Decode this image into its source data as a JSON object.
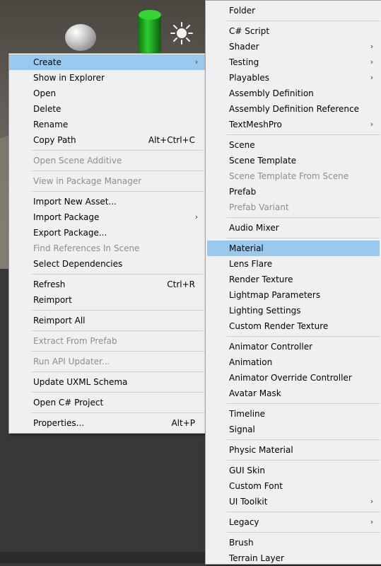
{
  "scene_icons": [
    "sphere-object",
    "cylinder-object",
    "directional-light-icon"
  ],
  "left_menu": {
    "items": [
      {
        "label": "Create",
        "submenu": true,
        "highlight": true
      },
      {
        "label": "Show in Explorer"
      },
      {
        "label": "Open"
      },
      {
        "label": "Delete"
      },
      {
        "label": "Rename"
      },
      {
        "label": "Copy Path",
        "shortcut": "Alt+Ctrl+C"
      },
      {
        "label": "Open Scene Additive",
        "disabled": true
      },
      {
        "label": "View in Package Manager",
        "disabled": true
      },
      {
        "label": "Import New Asset..."
      },
      {
        "label": "Import Package",
        "submenu": true
      },
      {
        "label": "Export Package..."
      },
      {
        "label": "Find References In Scene",
        "disabled": true
      },
      {
        "label": "Select Dependencies"
      },
      {
        "label": "Refresh",
        "shortcut": "Ctrl+R"
      },
      {
        "label": "Reimport"
      },
      {
        "label": "Reimport All"
      },
      {
        "label": "Extract From Prefab",
        "disabled": true
      },
      {
        "label": "Run API Updater...",
        "disabled": true
      },
      {
        "label": "Update UXML Schema"
      },
      {
        "label": "Open C# Project"
      },
      {
        "label": "Properties...",
        "shortcut": "Alt+P"
      }
    ]
  },
  "right_menu": {
    "items": [
      {
        "label": "Folder"
      },
      {
        "label": "C# Script"
      },
      {
        "label": "Shader",
        "submenu": true
      },
      {
        "label": "Testing",
        "submenu": true
      },
      {
        "label": "Playables",
        "submenu": true
      },
      {
        "label": "Assembly Definition"
      },
      {
        "label": "Assembly Definition Reference"
      },
      {
        "label": "TextMeshPro",
        "submenu": true
      },
      {
        "label": "Scene"
      },
      {
        "label": "Scene Template"
      },
      {
        "label": "Scene Template From Scene",
        "disabled": true
      },
      {
        "label": "Prefab"
      },
      {
        "label": "Prefab Variant",
        "disabled": true
      },
      {
        "label": "Audio Mixer"
      },
      {
        "label": "Material",
        "highlight": true
      },
      {
        "label": "Lens Flare"
      },
      {
        "label": "Render Texture"
      },
      {
        "label": "Lightmap Parameters"
      },
      {
        "label": "Lighting Settings"
      },
      {
        "label": "Custom Render Texture"
      },
      {
        "label": "Animator Controller"
      },
      {
        "label": "Animation"
      },
      {
        "label": "Animator Override Controller"
      },
      {
        "label": "Avatar Mask"
      },
      {
        "label": "Timeline"
      },
      {
        "label": "Signal"
      },
      {
        "label": "Physic Material"
      },
      {
        "label": "GUI Skin"
      },
      {
        "label": "Custom Font"
      },
      {
        "label": "UI Toolkit",
        "submenu": true
      },
      {
        "label": "Legacy",
        "submenu": true
      },
      {
        "label": "Brush"
      },
      {
        "label": "Terrain Layer"
      }
    ]
  },
  "colors": {
    "menu_bg": "#f0f0f0",
    "highlight": "#99c9ef",
    "disabled_text": "#8d8d8d",
    "separator": "#d0d0d0"
  }
}
